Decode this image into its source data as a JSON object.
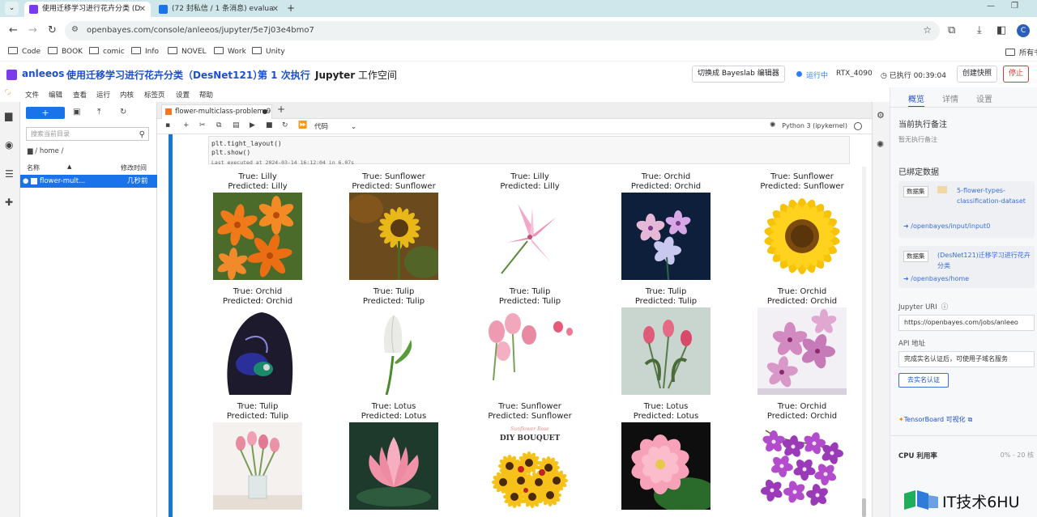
{
  "browser": {
    "tabs": [
      {
        "title": "使用迁移学习进行花卉分类 (D",
        "active": true,
        "favicon_color": "#7c3aed"
      },
      {
        "title": "(72 封私信 / 1 条消息) evalua",
        "active": false,
        "favicon_color": "#1a73e8"
      }
    ],
    "new_tab_label": "+",
    "url": "openbayes.com/console/anleeos/jupyter/5e7j03e4bmo7",
    "avatar_letter": "C",
    "bookmarks": [
      "Code",
      "BOOK",
      "comic",
      "Info",
      "NOVEL",
      "Work",
      "Unity"
    ],
    "bookmarks_overflow": "所有书"
  },
  "header": {
    "user": "anleeos",
    "project": "使用迁移学习进行花卉分类（DesNet121）",
    "run": "第 1 次执行",
    "workspace_bold": "Jupyter",
    "workspace_rest": " 工作空间",
    "switch_editor": "切换成 Bayeslab 编辑器",
    "status": "运行中",
    "gpu": "RTX_4090",
    "elapsed": "已执行 00:39:04",
    "snapshot": "创建快照",
    "stop": "停止"
  },
  "menu": [
    "文件",
    "编辑",
    "查看",
    "运行",
    "内核",
    "标签页",
    "设置",
    "帮助"
  ],
  "filebrowser": {
    "new_label": "+",
    "search_placeholder": "搜索当前目录",
    "breadcrumb": "/ home /",
    "col_name": "名称",
    "col_modified": "修改时间",
    "files": [
      {
        "name": "flower-mult...",
        "modified": "几秒前"
      }
    ]
  },
  "notebook": {
    "tab_title": "flower-multiclass-problem-9",
    "cell_type": "代码",
    "kernel": "Python 3 (ipykernel)",
    "code_lines": [
      "plt.tight_layout()",
      "plt.show()"
    ],
    "exec_info": "Last executed at 2024-03-14 16:12:04 in 6.07s",
    "predictions": [
      {
        "true": "True: Lilly",
        "pred": "Predicted: Lilly",
        "img": "lily-orange"
      },
      {
        "true": "True: Sunflower",
        "pred": "Predicted: Sunflower",
        "img": "sunflower-dark"
      },
      {
        "true": "True: Lilly",
        "pred": "Predicted: Lilly",
        "img": "lily-pink"
      },
      {
        "true": "True: Orchid",
        "pred": "Predicted: Orchid",
        "img": "orchid-blue"
      },
      {
        "true": "True: Sunflower",
        "pred": "Predicted: Sunflower",
        "img": "sunflower-bright"
      },
      {
        "true": "True: Orchid",
        "pred": "Predicted: Orchid",
        "img": "orchid-dark"
      },
      {
        "true": "True: Tulip",
        "pred": "Predicted: Tulip",
        "img": "tulip-white"
      },
      {
        "true": "True: Tulip",
        "pred": "Predicted: Tulip",
        "img": "tulip-pink"
      },
      {
        "true": "True: Tulip",
        "pred": "Predicted: Tulip",
        "img": "tulip-vase"
      },
      {
        "true": "True: Orchid",
        "pred": "Predicted: Orchid",
        "img": "orchid-pink"
      },
      {
        "true": "True: Tulip",
        "pred": "Predicted: Tulip",
        "img": "tulip-glass"
      },
      {
        "true": "True: Lotus",
        "pred": "Predicted: Lotus",
        "img": "lotus-dark"
      },
      {
        "true": "True: Sunflower",
        "pred": "Predicted: Sunflower",
        "img": "sunflower-bouquet"
      },
      {
        "true": "True: Lotus",
        "pred": "Predicted: Lotus",
        "img": "lotus-black"
      },
      {
        "true": "True: Orchid",
        "pred": "Predicted: Orchid",
        "img": "orchid-purple"
      }
    ],
    "bouquet_text": "DIY BOUQUET",
    "bouquet_script": "Sunflower Rose"
  },
  "rightpanel": {
    "tabs": [
      "概览",
      "详情",
      "设置"
    ],
    "note_title": "当前执行备注",
    "note_placeholder": "暂无执行备注",
    "bound_title": "已绑定数据",
    "datasets": [
      {
        "badge": "数据集",
        "name": "5-flower-types-classification-dataset",
        "path": "/openbayes/input/input0"
      },
      {
        "badge": "数据集",
        "name": "(DesNet121)迁移学习进行花卉分类",
        "path": "/openbayes/home"
      }
    ],
    "jupyter_uri_label": "Jupyter URI",
    "jupyter_uri": "https://openbayes.com/jobs/anleeo",
    "api_label": "API 地址",
    "api_value": "完成实名认证后，可使用子域名服务",
    "verify": "去实名认证",
    "tensorboard": "TensorBoard 可视化",
    "cpu_label": "CPU 利用率",
    "cpu_value": "0% - 20 核"
  },
  "watermark": "IT技术6HU",
  "colors": {
    "accent": "#1f4fcc",
    "cell_bar": "#1976d2",
    "stop": "#d23b3b",
    "brand_logo": "#7c3aed"
  }
}
